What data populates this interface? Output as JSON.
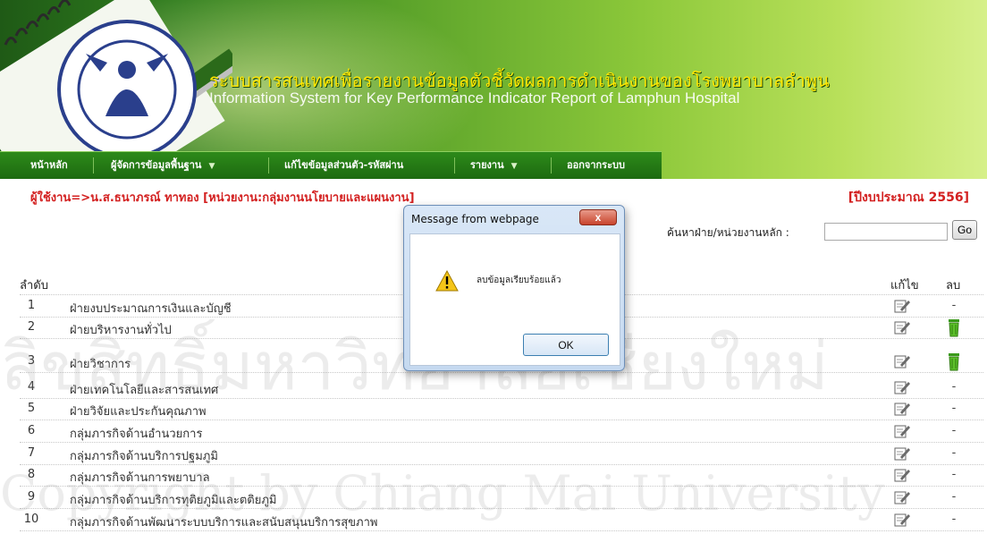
{
  "header": {
    "title_th": "ระบบสารสนเทศเพื่อรายงานข้อมูลตัวชี้วัดผลการดำเนินงานของโรงพยาบาลลำพูน",
    "title_en": "Information System for Key Performance Indicator Report of Lamphun Hospital"
  },
  "menu": {
    "items": [
      {
        "label": "หน้าหลัก"
      },
      {
        "label": "ผู้จัดการข้อมูลพื้นฐาน"
      },
      {
        "label": "แก้ไขข้อมูลส่วนตัว-รหัสผ่าน"
      },
      {
        "label": "รายงาน"
      },
      {
        "label": "ออกจากระบบ"
      }
    ]
  },
  "user_info": {
    "text": "ผู้ใช้งาน=>น.ส.ธนาภรณ์   ทาทอง   [หน่วยงาน:กลุ่มงานนโยบายและแผนงาน]"
  },
  "fiscal_year": {
    "text": "[ปีงบประมาณ  2556]"
  },
  "search": {
    "label": "ค้นหาฝ่าย/หน่วยงานหลัก  :",
    "value": "",
    "button_label": "Go"
  },
  "table": {
    "headers": {
      "no": "ลำดับ",
      "edit": "แก้ไข",
      "delete": "ลบ"
    },
    "rows": [
      {
        "no": "1",
        "name": "ฝ่ายงบประมาณการเงินและบัญชี",
        "delete": "-"
      },
      {
        "no": "2",
        "name": "ฝ่ายบริหารงานทั่วไป",
        "delete": "trash-icon"
      },
      {
        "no": "3",
        "name": "ฝ่ายวิชาการ",
        "delete": "trash-icon"
      },
      {
        "no": "4",
        "name": "ฝ่ายเทคโนโลยีและสารสนเทศ",
        "delete": "-"
      },
      {
        "no": "5",
        "name": "ฝ่ายวิจัยและประกันคุณภาพ",
        "delete": "-"
      },
      {
        "no": "6",
        "name": "กลุ่มภารกิจด้านอำนวยการ",
        "delete": "-"
      },
      {
        "no": "7",
        "name": "กลุ่มภารกิจด้านบริการปฐมภูมิ",
        "delete": "-"
      },
      {
        "no": "8",
        "name": "กลุ่มภารกิจด้านการพยาบาล",
        "delete": "-"
      },
      {
        "no": "9",
        "name": "กลุ่มภารกิจด้านบริการทุติยภูมิและตติยภูมิ",
        "delete": "-"
      },
      {
        "no": "10",
        "name": "กลุ่มภารกิจด้านพัฒนาระบบบริการและสนับสนุนบริการสุขภาพ",
        "delete": "-"
      }
    ]
  },
  "dialog": {
    "title": "Message from webpage",
    "close_label": "x",
    "message": "ลบข้อมูลเรียบร้อยแล้ว",
    "ok_label": "OK",
    "icon": "warning-icon"
  },
  "watermark": {
    "line1": "ลิขสิทธิ์มหาวิทยาลัยเชียงใหม่",
    "line2": "Copyright by Chiang Mai University"
  },
  "colors": {
    "accent_red": "#d32020",
    "menu_green": "#2d8a1a",
    "banner_yellow": "#ffe600"
  }
}
